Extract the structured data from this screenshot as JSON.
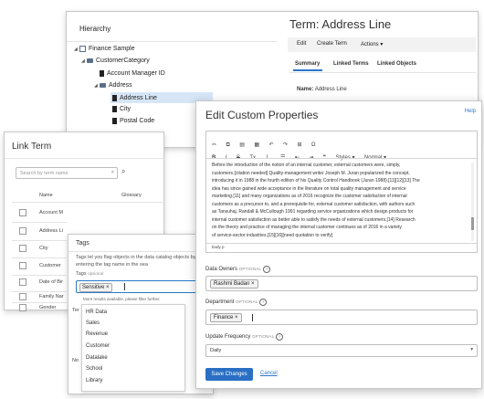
{
  "hierarchy": {
    "title": "Hierarchy",
    "root": "Finance Sample",
    "category": "CustomerCategory",
    "nodes": [
      "Account Manager ID",
      "Address",
      "Address Line",
      "City",
      "Postal Code"
    ]
  },
  "term": {
    "title": "Term: Address Line",
    "buttons": {
      "edit": "Edit",
      "create": "Create Term",
      "actions": "Actions"
    },
    "tabs": [
      "Summary",
      "Linked Terms",
      "Linked Objects"
    ],
    "name_label": "Name:",
    "name_value": "Address Line"
  },
  "link_term": {
    "title": "Link Term",
    "search_placeholder": "Search by term name",
    "columns": {
      "name": "Name",
      "glossary": "Glossary"
    },
    "rows": [
      "Account M",
      "Address Li",
      "City",
      "Customer",
      "Date of Bir",
      "Family Nar",
      "Gender"
    ]
  },
  "tags": {
    "title": "Tags",
    "description": "Tags let you flag objects in the data catalog objects by entering the tag name in the sea",
    "label": "Tags",
    "label_optional": "optional",
    "chip": "Sensitive",
    "more_results": "More results available, please filter further.",
    "options": [
      "HR Data",
      "Sales",
      "Revenue",
      "Customer",
      "Datalake",
      "School",
      "Library"
    ],
    "behind_labels": [
      "Ter",
      "No"
    ]
  },
  "custom": {
    "title": "Edit Custom Properties",
    "help": "Help",
    "toolbar": {
      "styles": "Styles",
      "normal": "Normal",
      "body_tag": "body p"
    },
    "editor_text": [
      "Before the introduction of the notion of an internal customer, external customers were, simply,",
      "customers.[citation needed] Quality-management writer Joseph M. Juran popularized the concept,",
      "introducing it in 1988 in the fourth edition of his Quality Control Handbook (Juran 1988).[11][12][13] The",
      "idea has since gained wide acceptance in the literature on total quality management and service",
      "marketing.[11] and many organizations as of 2016 recognize the customer satisfaction of internal",
      "customers as a precursor to, and a prerequisite for, external customer satisfaction, with authors such",
      "as Tansuhaj, Randall & McCullough 1991 regarding service organizations which design products for",
      "internal customer satisfaction as better able to satisfy the needs of external customers.[14] Research",
      "on the theory and practice of managing the internal customer continues as of 2016 in a variety",
      "of service-sector industries.[15][16][need quotation to verify]"
    ],
    "data_owners_label": "Data Owners",
    "data_owners_chip": "Rashmi Badan",
    "department_label": "Department",
    "department_chip": "Finance",
    "update_label": "Update Frequency",
    "update_value": "Daily",
    "optional": "OPTIONAL",
    "save": "Save Changes",
    "cancel": "Cancel"
  },
  "colors": {
    "accent": "#2a78c9",
    "selected": "#d6e6f7",
    "primary_btn": "#2a6fc4"
  }
}
